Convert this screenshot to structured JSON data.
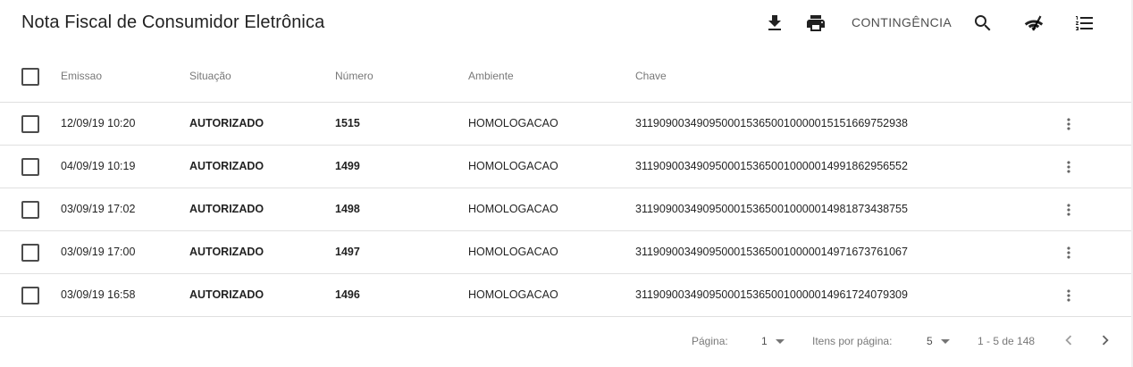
{
  "header": {
    "title": "Nota Fiscal de Consumidor Eletrônica",
    "actions": [
      {
        "name": "download-icon"
      },
      {
        "name": "print-icon"
      },
      {
        "name": "contingencia",
        "label": "CONTINGÊNCIA"
      },
      {
        "name": "search-icon"
      },
      {
        "name": "wifi-off-icon"
      },
      {
        "name": "list-icon"
      }
    ]
  },
  "table": {
    "columns": [
      "Emissao",
      "Situação",
      "Número",
      "Ambiente",
      "Chave"
    ],
    "rows": [
      {
        "emissao": "12/09/19 10:20",
        "situacao": "AUTORIZADO",
        "numero": "1515",
        "ambiente": "HOMOLOGACAO",
        "chave": "31190900349095000153650010000015151669752938"
      },
      {
        "emissao": "04/09/19 10:19",
        "situacao": "AUTORIZADO",
        "numero": "1499",
        "ambiente": "HOMOLOGACAO",
        "chave": "31190900349095000153650010000014991862956552"
      },
      {
        "emissao": "03/09/19 17:02",
        "situacao": "AUTORIZADO",
        "numero": "1498",
        "ambiente": "HOMOLOGACAO",
        "chave": "31190900349095000153650010000014981873438755"
      },
      {
        "emissao": "03/09/19 17:00",
        "situacao": "AUTORIZADO",
        "numero": "1497",
        "ambiente": "HOMOLOGACAO",
        "chave": "31190900349095000153650010000014971673761067"
      },
      {
        "emissao": "03/09/19 16:58",
        "situacao": "AUTORIZADO",
        "numero": "1496",
        "ambiente": "HOMOLOGACAO",
        "chave": "31190900349095000153650010000014961724079309"
      }
    ]
  },
  "paginator": {
    "page_label": "Página:",
    "page_value": "1",
    "items_label": "Itens por página:",
    "items_value": "5",
    "range": "1 - 5 de 148"
  },
  "colors": {
    "text_primary": "#212121",
    "text_secondary": "#757575",
    "divider": "#e0e0e0",
    "nav_disabled": "#9e9e9e",
    "nav_enabled": "#616161"
  }
}
